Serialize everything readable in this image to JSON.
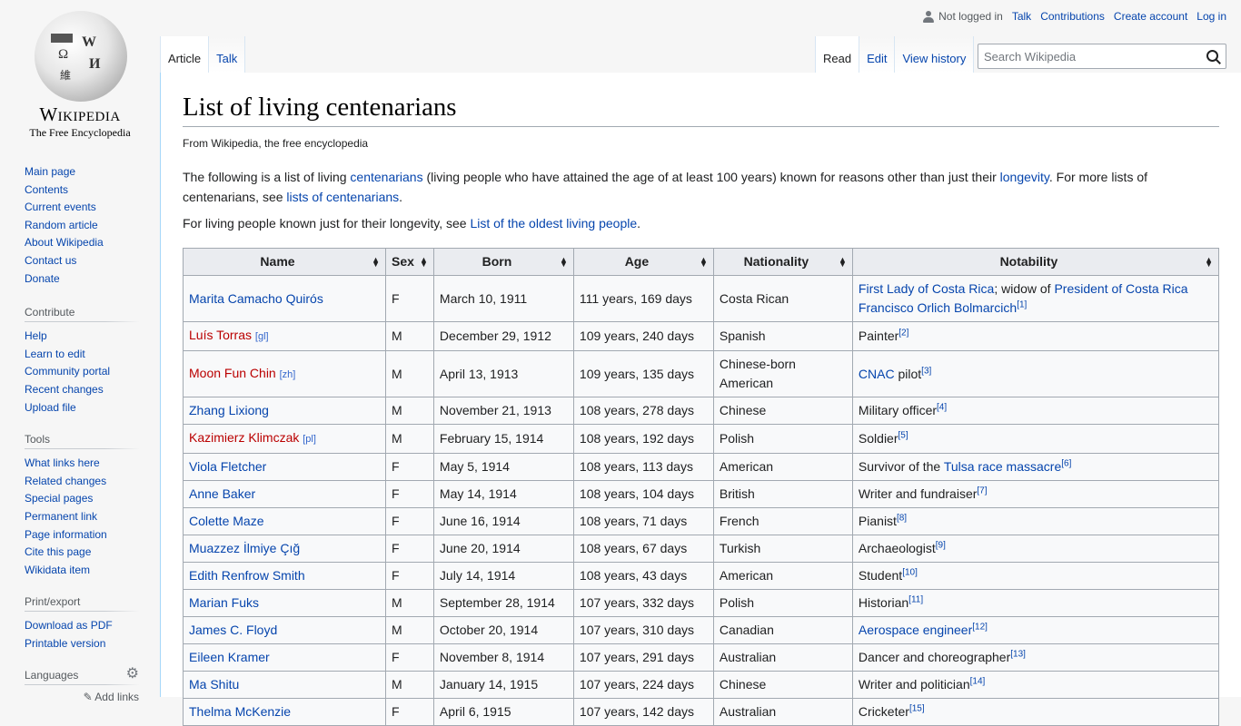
{
  "logo": {
    "wordmark": "Wikipedia",
    "tagline": "The Free Encyclopedia",
    "glyphs": [
      "Ω",
      "W",
      "И",
      "維"
    ]
  },
  "personal": {
    "not_logged_in": "Not logged in",
    "talk": "Talk",
    "contributions": "Contributions",
    "create_account": "Create account",
    "log_in": "Log in"
  },
  "tabs": {
    "left": [
      {
        "label": "Article",
        "selected": true
      },
      {
        "label": "Talk",
        "selected": false
      }
    ],
    "right": [
      {
        "label": "Read",
        "selected": true
      },
      {
        "label": "Edit",
        "selected": false
      },
      {
        "label": "View history",
        "selected": false
      }
    ]
  },
  "search": {
    "placeholder": "Search Wikipedia",
    "value": ""
  },
  "sidebar": {
    "navigation": [
      "Main page",
      "Contents",
      "Current events",
      "Random article",
      "About Wikipedia",
      "Contact us",
      "Donate"
    ],
    "contribute": {
      "heading": "Contribute",
      "items": [
        "Help",
        "Learn to edit",
        "Community portal",
        "Recent changes",
        "Upload file"
      ]
    },
    "tools": {
      "heading": "Tools",
      "items": [
        "What links here",
        "Related changes",
        "Special pages",
        "Permanent link",
        "Page information",
        "Cite this page",
        "Wikidata item"
      ]
    },
    "print": {
      "heading": "Print/export",
      "items": [
        "Download as PDF",
        "Printable version"
      ]
    },
    "languages": {
      "heading": "Languages",
      "add_links": "Add links"
    }
  },
  "article": {
    "title": "List of living centenarians",
    "subtitle": "From Wikipedia, the free encyclopedia",
    "p1": {
      "t1": "The following is a list of living ",
      "l1": "centenarians",
      "t2": " (living people who have attained the age of at least 100 years) known for reasons other than just their ",
      "l2": "longevity",
      "t3": ". For more lists of centenarians, see ",
      "l3": "lists of centenarians",
      "t4": "."
    },
    "p2": {
      "t1": "For living people known just for their longevity, see ",
      "l1": "List of the oldest living people",
      "t2": "."
    }
  },
  "table": {
    "headers": [
      "Name",
      "Sex",
      "Born",
      "Age",
      "Nationality",
      "Notability"
    ],
    "rows": [
      {
        "name": "Marita Camacho Quirós",
        "red": false,
        "ext": "",
        "sex": "F",
        "born": "March 10, 1911",
        "age": "111 years, 169 days",
        "nationality": "Costa Rican",
        "notability": [
          {
            "text": "First Lady of Costa Rica",
            "link": true
          },
          {
            "text": "; widow of ",
            "link": false
          },
          {
            "text": "President of Costa Rica",
            "link": true
          },
          {
            "text": " ",
            "link": false
          },
          {
            "text": "Francisco Orlich Bolmarcich",
            "link": true
          }
        ],
        "ref": "[1]"
      },
      {
        "name": "Luís Torras",
        "red": true,
        "ext": "[gl]",
        "sex": "M",
        "born": "December 29, 1912",
        "age": "109 years, 240 days",
        "nationality": "Spanish",
        "notability": [
          {
            "text": "Painter",
            "link": false
          }
        ],
        "ref": "[2]"
      },
      {
        "name": "Moon Fun Chin",
        "red": true,
        "ext": "[zh]",
        "sex": "M",
        "born": "April 13, 1913",
        "age": "109 years, 135 days",
        "nationality": "Chinese-born American",
        "notability": [
          {
            "text": "CNAC",
            "link": true
          },
          {
            "text": " pilot",
            "link": false
          }
        ],
        "ref": "[3]"
      },
      {
        "name": "Zhang Lixiong",
        "red": false,
        "ext": "",
        "sex": "M",
        "born": "November 21, 1913",
        "age": "108 years, 278 days",
        "nationality": "Chinese",
        "notability": [
          {
            "text": "Military officer",
            "link": false
          }
        ],
        "ref": "[4]"
      },
      {
        "name": "Kazimierz Klimczak",
        "red": true,
        "ext": "[pl]",
        "sex": "M",
        "born": "February 15, 1914",
        "age": "108 years, 192 days",
        "nationality": "Polish",
        "notability": [
          {
            "text": "Soldier",
            "link": false
          }
        ],
        "ref": "[5]"
      },
      {
        "name": "Viola Fletcher",
        "red": false,
        "ext": "",
        "sex": "F",
        "born": "May 5, 1914",
        "age": "108 years, 113 days",
        "nationality": "American",
        "notability": [
          {
            "text": "Survivor of the ",
            "link": false
          },
          {
            "text": "Tulsa race massacre",
            "link": true
          }
        ],
        "ref": "[6]"
      },
      {
        "name": "Anne Baker",
        "red": false,
        "ext": "",
        "sex": "F",
        "born": "May 14, 1914",
        "age": "108 years, 104 days",
        "nationality": "British",
        "notability": [
          {
            "text": "Writer and fundraiser",
            "link": false
          }
        ],
        "ref": "[7]"
      },
      {
        "name": "Colette Maze",
        "red": false,
        "ext": "",
        "sex": "F",
        "born": "June 16, 1914",
        "age": "108 years, 71 days",
        "nationality": "French",
        "notability": [
          {
            "text": "Pianist",
            "link": false
          }
        ],
        "ref": "[8]"
      },
      {
        "name": "Muazzez İlmiye Çığ",
        "red": false,
        "ext": "",
        "sex": "F",
        "born": "June 20, 1914",
        "age": "108 years, 67 days",
        "nationality": "Turkish",
        "notability": [
          {
            "text": "Archaeologist",
            "link": false
          }
        ],
        "ref": "[9]"
      },
      {
        "name": "Edith Renfrow Smith",
        "red": false,
        "ext": "",
        "sex": "F",
        "born": "July 14, 1914",
        "age": "108 years, 43 days",
        "nationality": "American",
        "notability": [
          {
            "text": "Student",
            "link": false
          }
        ],
        "ref": "[10]"
      },
      {
        "name": "Marian Fuks",
        "red": false,
        "ext": "",
        "sex": "M",
        "born": "September 28, 1914",
        "age": "107 years, 332 days",
        "nationality": "Polish",
        "notability": [
          {
            "text": "Historian",
            "link": false
          }
        ],
        "ref": "[11]"
      },
      {
        "name": "James C. Floyd",
        "red": false,
        "ext": "",
        "sex": "M",
        "born": "October 20, 1914",
        "age": "107 years, 310 days",
        "nationality": "Canadian",
        "notability": [
          {
            "text": "Aerospace engineer",
            "link": true
          }
        ],
        "ref": "[12]"
      },
      {
        "name": "Eileen Kramer",
        "red": false,
        "ext": "",
        "sex": "F",
        "born": "November 8, 1914",
        "age": "107 years, 291 days",
        "nationality": "Australian",
        "notability": [
          {
            "text": "Dancer and choreographer",
            "link": false
          }
        ],
        "ref": "[13]"
      },
      {
        "name": "Ma Shitu",
        "red": false,
        "ext": "",
        "sex": "M",
        "born": "January 14, 1915",
        "age": "107 years, 224 days",
        "nationality": "Chinese",
        "notability": [
          {
            "text": "Writer and politician",
            "link": false
          }
        ],
        "ref": "[14]"
      },
      {
        "name": "Thelma McKenzie",
        "red": false,
        "ext": "",
        "sex": "F",
        "born": "April 6, 1915",
        "age": "107 years, 142 days",
        "nationality": "Australian",
        "notability": [
          {
            "text": "Cricketer",
            "link": false
          }
        ],
        "ref": "[15]"
      }
    ]
  }
}
